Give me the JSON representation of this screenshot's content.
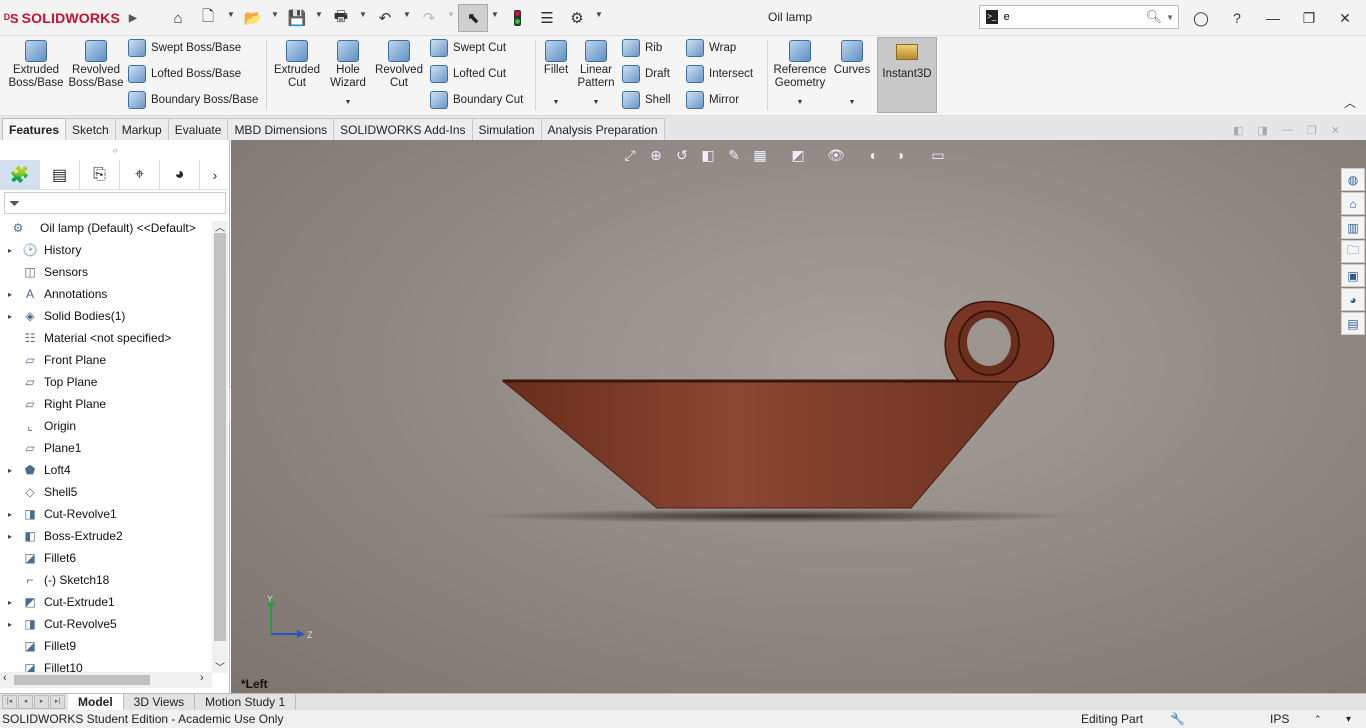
{
  "app": {
    "brand": "SOLIDWORKS",
    "doc_title": "Oil lamp"
  },
  "search": {
    "value": "e"
  },
  "ribbon": {
    "extruded_boss": "Extruded Boss/Base",
    "revolved_boss": "Revolved Boss/Base",
    "swept_boss": "Swept Boss/Base",
    "lofted_boss": "Lofted Boss/Base",
    "boundary_boss": "Boundary Boss/Base",
    "extruded_cut": "Extruded Cut",
    "hole_wizard": "Hole Wizard",
    "revolved_cut": "Revolved Cut",
    "swept_cut": "Swept Cut",
    "lofted_cut": "Lofted Cut",
    "boundary_cut": "Boundary Cut",
    "fillet": "Fillet",
    "linear_pattern": "Linear Pattern",
    "rib": "Rib",
    "draft": "Draft",
    "shell": "Shell",
    "wrap": "Wrap",
    "intersect": "Intersect",
    "mirror": "Mirror",
    "reference_geometry": "Reference Geometry",
    "curves": "Curves",
    "instant3d": "Instant3D"
  },
  "tabs": [
    "Features",
    "Sketch",
    "Markup",
    "Evaluate",
    "MBD Dimensions",
    "SOLIDWORKS Add-Ins",
    "Simulation",
    "Analysis Preparation"
  ],
  "tree": {
    "root": "Oil lamp (Default) <<Default>",
    "nodes": [
      {
        "label": "History",
        "exp": "▸",
        "icon": "history-icon"
      },
      {
        "label": "Sensors",
        "exp": "",
        "icon": "sensors-icon"
      },
      {
        "label": "Annotations",
        "exp": "▸",
        "icon": "annotations-icon"
      },
      {
        "label": "Solid Bodies(1)",
        "exp": "▸",
        "icon": "solid-bodies-icon"
      },
      {
        "label": "Material <not specified>",
        "exp": "",
        "icon": "material-icon"
      },
      {
        "label": "Front Plane",
        "exp": "",
        "icon": "plane-icon"
      },
      {
        "label": "Top Plane",
        "exp": "",
        "icon": "plane-icon"
      },
      {
        "label": "Right Plane",
        "exp": "",
        "icon": "plane-icon"
      },
      {
        "label": "Origin",
        "exp": "",
        "icon": "origin-icon"
      },
      {
        "label": "Plane1",
        "exp": "",
        "icon": "plane-icon"
      },
      {
        "label": "Loft4",
        "exp": "▸",
        "icon": "loft-icon"
      },
      {
        "label": "Shell5",
        "exp": "",
        "icon": "shell-icon"
      },
      {
        "label": "Cut-Revolve1",
        "exp": "▸",
        "icon": "cut-revolve-icon"
      },
      {
        "label": "Boss-Extrude2",
        "exp": "▸",
        "icon": "boss-extrude-icon"
      },
      {
        "label": "Fillet6",
        "exp": "",
        "icon": "fillet-icon"
      },
      {
        "label": "(-) Sketch18",
        "exp": "",
        "icon": "sketch-icon"
      },
      {
        "label": "Cut-Extrude1",
        "exp": "▸",
        "icon": "cut-extrude-icon"
      },
      {
        "label": "Cut-Revolve5",
        "exp": "▸",
        "icon": "cut-revolve-icon"
      },
      {
        "label": "Fillet9",
        "exp": "",
        "icon": "fillet-icon"
      },
      {
        "label": "Fillet10",
        "exp": "",
        "icon": "fillet-icon"
      }
    ]
  },
  "viewport": {
    "view_name": "*Left",
    "triad_y": "Y",
    "triad_z": "Z"
  },
  "bottom_tabs": [
    "Model",
    "3D Views",
    "Motion Study 1"
  ],
  "status": {
    "edition": "SOLIDWORKS Student Edition - Academic Use Only",
    "mode": "Editing Part",
    "units": "IPS"
  },
  "colors": {
    "brand": "#c8102e",
    "model": "#7a3a26",
    "viewport": "#8e8680"
  }
}
